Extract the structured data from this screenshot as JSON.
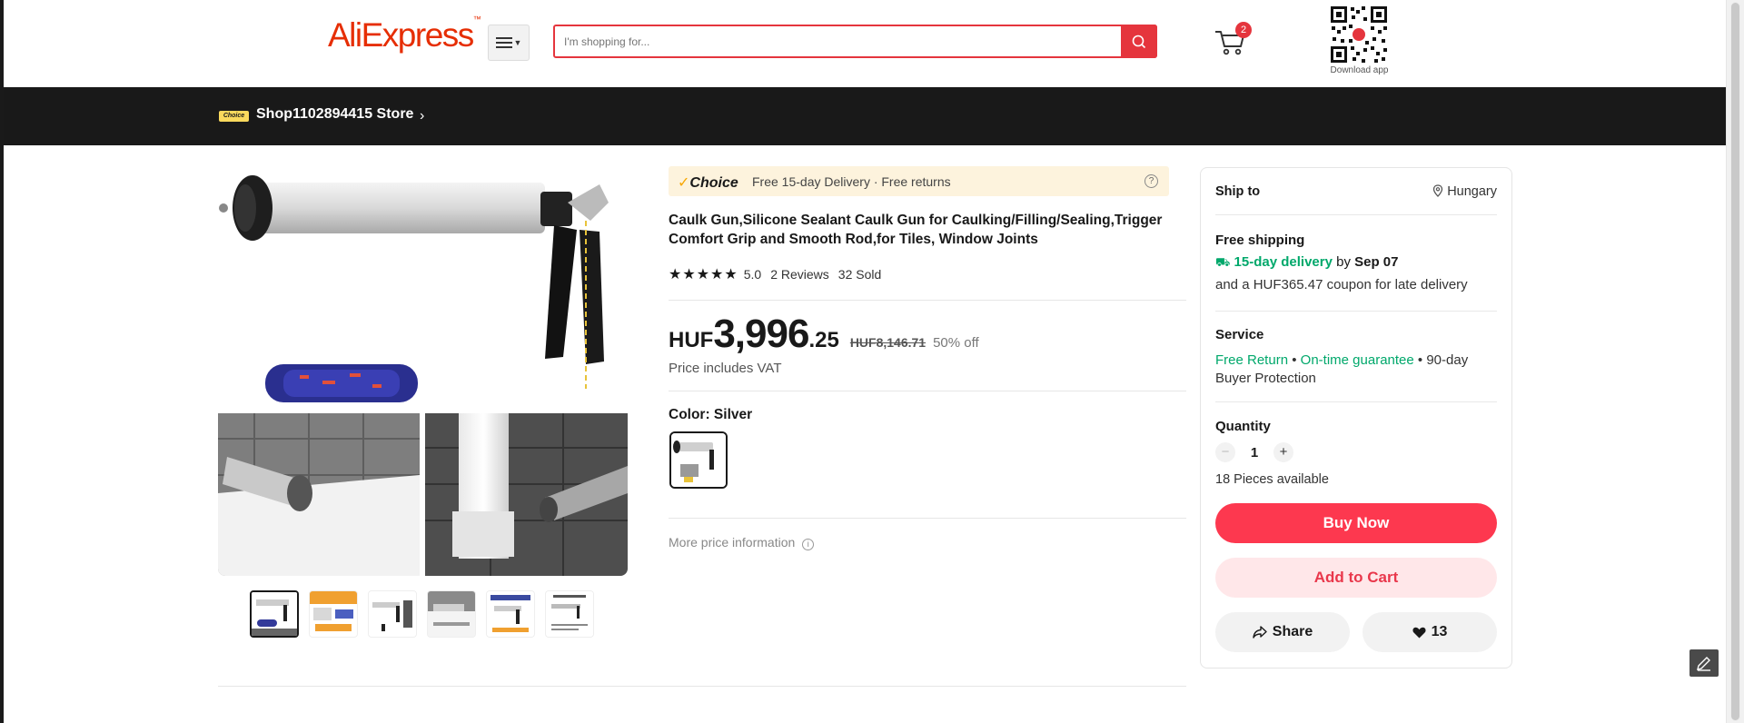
{
  "header": {
    "logo": "AliExpress",
    "logo_tm": "™",
    "search_placeholder": "I'm shopping for...",
    "cart_count": "2",
    "qr_label": "Download app",
    "accent_color": "#e5353d"
  },
  "store": {
    "badge": "Choice",
    "name": "Shop1102894415 Store",
    "arrow": "›"
  },
  "product": {
    "choice_brand": "Choice",
    "choice_text": "Free 15-day Delivery · Free returns",
    "help_icon": "?",
    "title": "Caulk Gun,Silicone Sealant Caulk Gun for Caulking/Filling/Sealing,Trigger Comfort Grip and Smooth Rod,for Tiles, Window Joints",
    "stars": "★★★★★",
    "rating": "5.0",
    "reviews": "2 Reviews",
    "sold": "32 Sold",
    "price_currency": "HUF",
    "price_integer": "3,996",
    "price_decimal": ".25",
    "price_original": "HUF8,146.71",
    "discount": "50% off",
    "vat_note": "Price includes VAT",
    "color_label": "Color: Silver",
    "more_price": "More price information",
    "info_icon": "i"
  },
  "thumbnails": [
    "thumb-1",
    "thumb-2",
    "thumb-3",
    "thumb-4",
    "thumb-5",
    "thumb-6"
  ],
  "panel": {
    "ship_to": "Ship to",
    "country": "Hungary",
    "free_shipping": "Free shipping",
    "delivery_days": "15-day delivery",
    "delivery_by": "by",
    "delivery_date": "Sep 07",
    "coupon": "and a HUF365.47 coupon for late delivery",
    "service_heading": "Service",
    "free_return": "Free Return",
    "ontime": "On-time guarantee",
    "protection": "• 90-day Buyer Protection",
    "bullet": "•",
    "quantity_heading": "Quantity",
    "quantity_value": "1",
    "available": "18 Pieces available",
    "buy_now": "Buy Now",
    "add_to_cart": "Add to Cart",
    "share": "Share",
    "wishlist_count": "13"
  }
}
